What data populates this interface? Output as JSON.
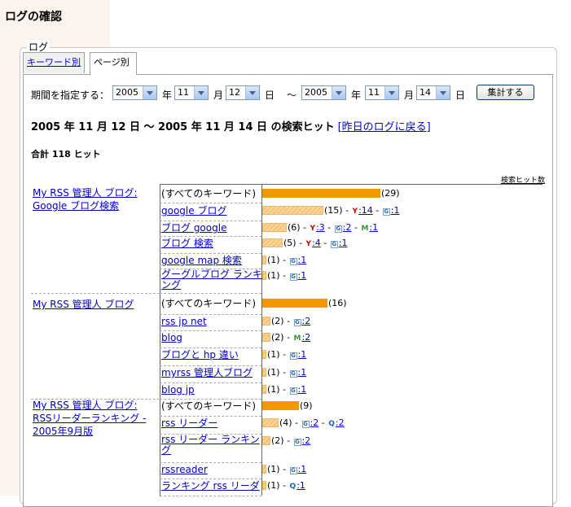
{
  "page_title": "ログの確認",
  "fieldset_legend": "ログ",
  "tabs": [
    {
      "label": "キーワード別",
      "active": false
    },
    {
      "label": "ページ別",
      "active": true
    }
  ],
  "period": {
    "label": "期間を指定する：",
    "from_year": "2005",
    "from_month": "11",
    "from_day": "12",
    "to_year": "2005",
    "to_month": "11",
    "to_day": "14",
    "year_unit": "年",
    "month_unit": "月",
    "day_unit": "日",
    "tilde": "〜",
    "submit_label": "集計する"
  },
  "heading": {
    "text": "2005 年 11 月 12 日 〜 2005 年 11 月 14 日 の検索ヒット",
    "back_link": "[昨日のログに戻る]"
  },
  "total": "合計 118 ヒット",
  "column_header": "検索ヒット数",
  "groups": [
    {
      "title": "My RSS 管理人 ブログ: Google ブログ検索",
      "rows": [
        {
          "keyword": "(すべてのキーワード)",
          "count": 29,
          "detail": "(29)"
        },
        {
          "keyword": "google ブログ",
          "count": 15,
          "detail": "(15) - ",
          "engines": [
            {
              "icon": "y",
              "text": ":14"
            },
            {
              "icon": "g",
              "text": ":1"
            }
          ]
        },
        {
          "keyword": "ブログ google",
          "count": 6,
          "detail": "(6) - ",
          "engines": [
            {
              "icon": "y",
              "text": ":3"
            },
            {
              "icon": "g",
              "text": ":2"
            },
            {
              "icon": "m",
              "text": ":1"
            }
          ]
        },
        {
          "keyword": "ブログ 検索",
          "count": 5,
          "detail": "(5) - ",
          "engines": [
            {
              "icon": "y",
              "text": ":4"
            },
            {
              "icon": "g",
              "text": ":1"
            }
          ]
        },
        {
          "keyword": "google map 検索",
          "count": 1,
          "detail": "(1) - ",
          "engines": [
            {
              "icon": "g",
              "text": ":1"
            }
          ]
        },
        {
          "keyword": "グーグルブログ ランキング",
          "count": 1,
          "detail": "(1) - ",
          "engines": [
            {
              "icon": "g",
              "text": ":1"
            }
          ]
        }
      ]
    },
    {
      "title": "My RSS 管理人 ブログ",
      "rows": [
        {
          "keyword": "(すべてのキーワード)",
          "count": 16,
          "detail": "(16)"
        },
        {
          "keyword": "rss jp net",
          "count": 2,
          "detail": "(2) - ",
          "engines": [
            {
              "icon": "g",
              "text": ":2"
            }
          ]
        },
        {
          "keyword": "blog",
          "count": 2,
          "detail": "(2) - ",
          "engines": [
            {
              "icon": "m",
              "text": ":2"
            }
          ]
        },
        {
          "keyword": "ブログと hp 違い",
          "count": 1,
          "detail": "(1) - ",
          "engines": [
            {
              "icon": "g",
              "text": ":1"
            }
          ]
        },
        {
          "keyword": "myrss 管理人ブログ",
          "count": 1,
          "detail": "(1) - ",
          "engines": [
            {
              "icon": "g",
              "text": ":1"
            }
          ]
        },
        {
          "keyword": "blog jp",
          "count": 1,
          "detail": "(1) - ",
          "engines": [
            {
              "icon": "g",
              "text": ":1"
            }
          ]
        }
      ]
    },
    {
      "title": "My RSS 管理人 ブログ: RSSリーダーランキング - 2005年9月版",
      "rows": [
        {
          "keyword": "(すべてのキーワード)",
          "count": 9,
          "detail": "(9)"
        },
        {
          "keyword": "rss リーダー",
          "count": 4,
          "detail": "(4) - ",
          "engines": [
            {
              "icon": "g",
              "text": ":2"
            },
            {
              "icon": "q",
              "text": ":2"
            }
          ]
        },
        {
          "keyword": "rss リーダー ランキング",
          "count": 2,
          "detail": "(2) - ",
          "engines": [
            {
              "icon": "g",
              "text": ":2"
            }
          ]
        },
        {
          "keyword": "rssreader",
          "count": 1,
          "detail": "(1) - ",
          "engines": [
            {
              "icon": "g",
              "text": ":1"
            }
          ]
        },
        {
          "keyword": "ランキング rss リーダ",
          "count": 1,
          "detail": "(1) - ",
          "engines": [
            {
              "icon": "q",
              "text": ":1"
            }
          ]
        }
      ]
    }
  ],
  "colors": {
    "bar_total": "#f39800",
    "bar_part": "#fbd7a0",
    "link": "#0000cc"
  }
}
